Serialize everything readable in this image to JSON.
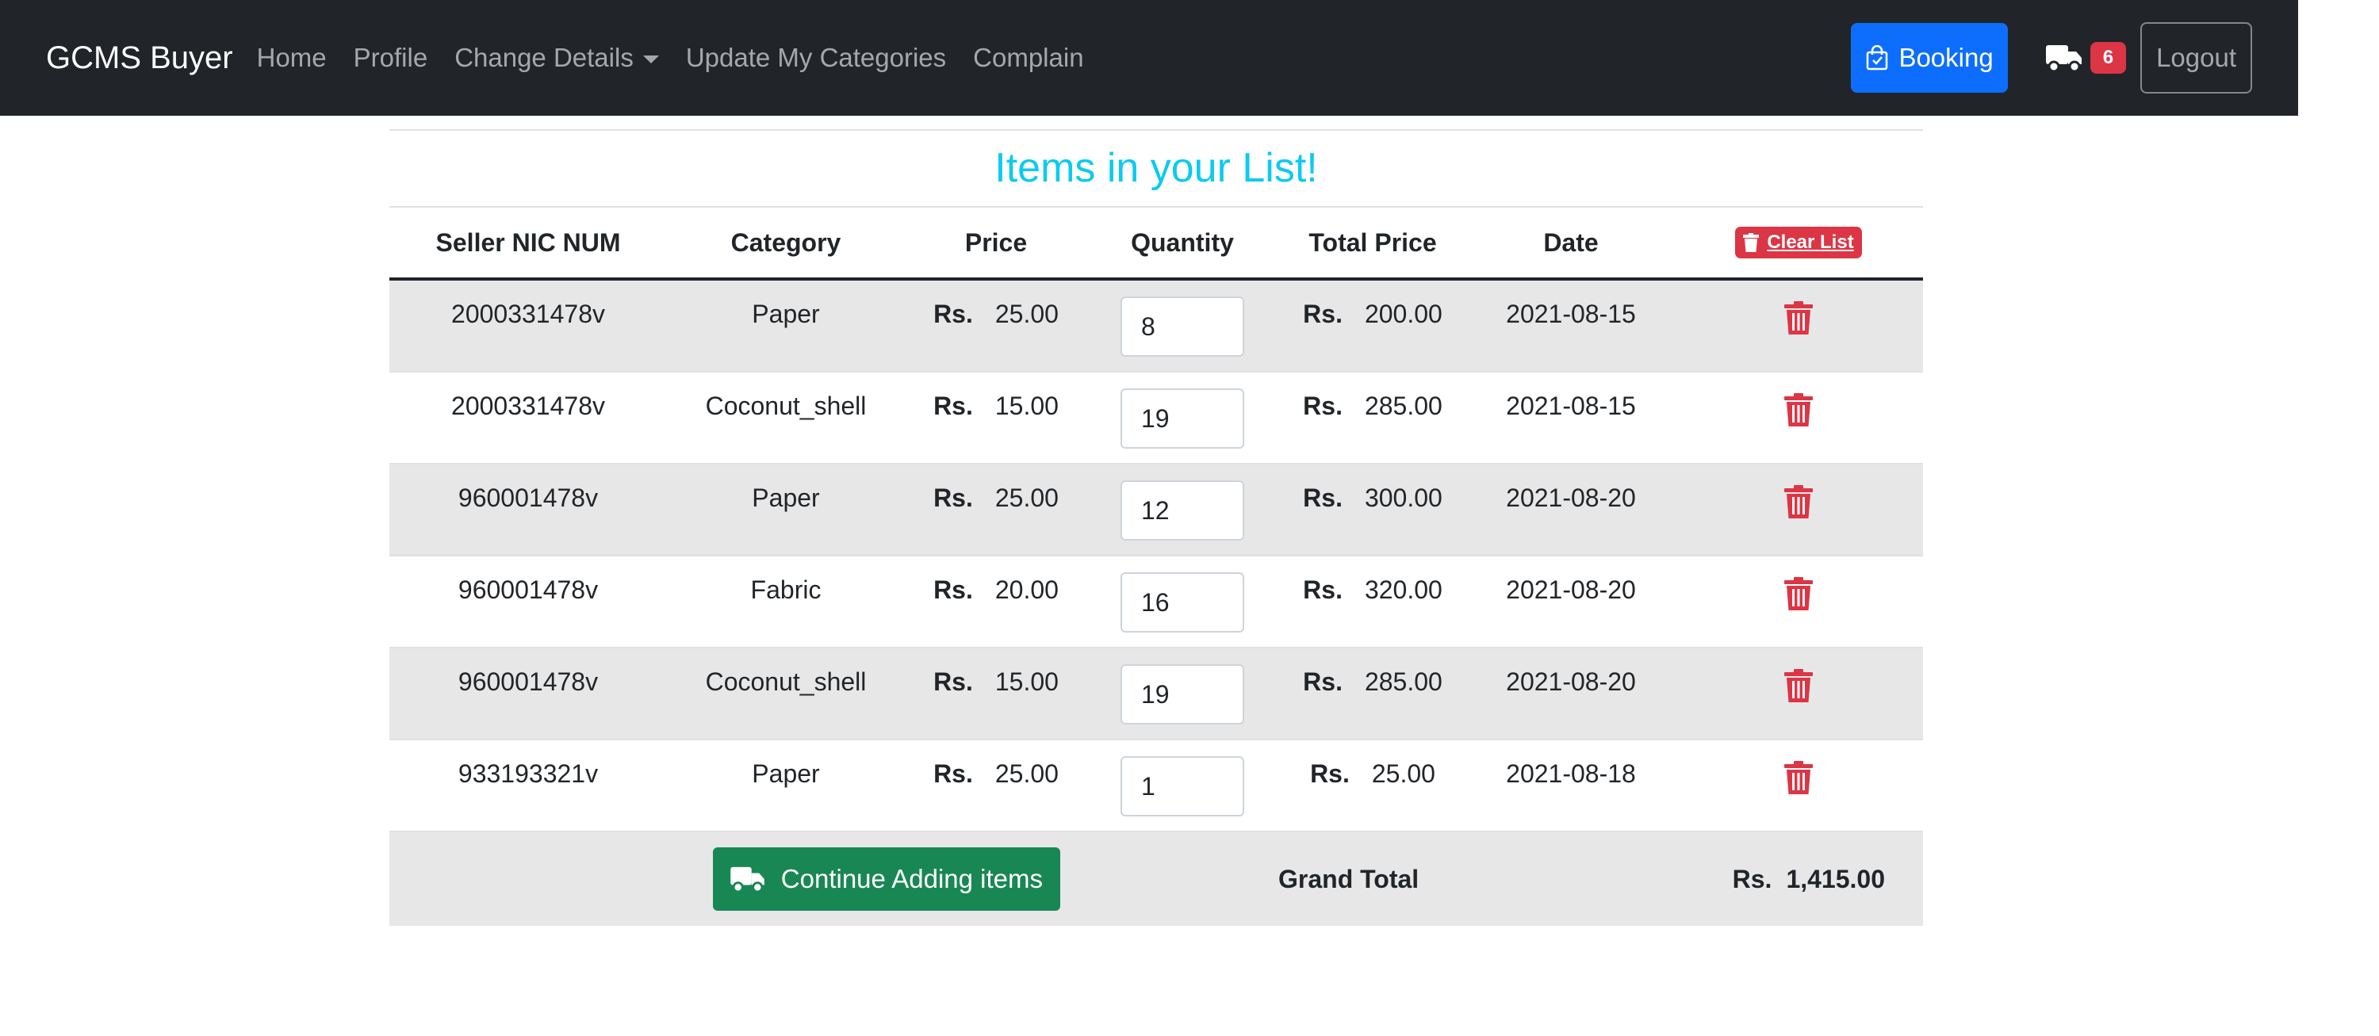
{
  "navbar": {
    "brand": "GCMS Buyer",
    "links": [
      "Home",
      "Profile",
      "Change Details",
      "Update My Categories",
      "Complain"
    ],
    "booking_label": "Booking",
    "cart_count": "6",
    "logout_label": "Logout"
  },
  "list": {
    "title": "Items in your List!",
    "headers": [
      "Seller NIC NUM",
      "Category",
      "Price",
      "Quantity",
      "Total Price",
      "Date"
    ],
    "clear_label": "Clear List",
    "currency": "Rs.",
    "rows": [
      {
        "seller": "2000331478v",
        "category": "Paper",
        "price": "25.00",
        "qty": "8",
        "total": "200.00",
        "date": "2021-08-15"
      },
      {
        "seller": "2000331478v",
        "category": "Coconut_shell",
        "price": "15.00",
        "qty": "19",
        "total": "285.00",
        "date": "2021-08-15"
      },
      {
        "seller": "960001478v",
        "category": "Paper",
        "price": "25.00",
        "qty": "12",
        "total": "300.00",
        "date": "2021-08-20"
      },
      {
        "seller": "960001478v",
        "category": "Fabric",
        "price": "20.00",
        "qty": "16",
        "total": "320.00",
        "date": "2021-08-20"
      },
      {
        "seller": "960001478v",
        "category": "Coconut_shell",
        "price": "15.00",
        "qty": "19",
        "total": "285.00",
        "date": "2021-08-20"
      },
      {
        "seller": "933193321v",
        "category": "Paper",
        "price": "25.00",
        "qty": "1",
        "total": "25.00",
        "date": "2021-08-18"
      }
    ],
    "continue_label": "Continue Adding items",
    "grand_total_label": "Grand Total",
    "grand_total_value": "1,415.00"
  },
  "colors": {
    "navbar_bg": "#212529",
    "title": "#0dcaf0",
    "danger": "#dc3545",
    "primary": "#0d6efd",
    "success": "#198754"
  },
  "icons": [
    "shopping-bag-icon",
    "truck-icon",
    "trash-icon"
  ]
}
